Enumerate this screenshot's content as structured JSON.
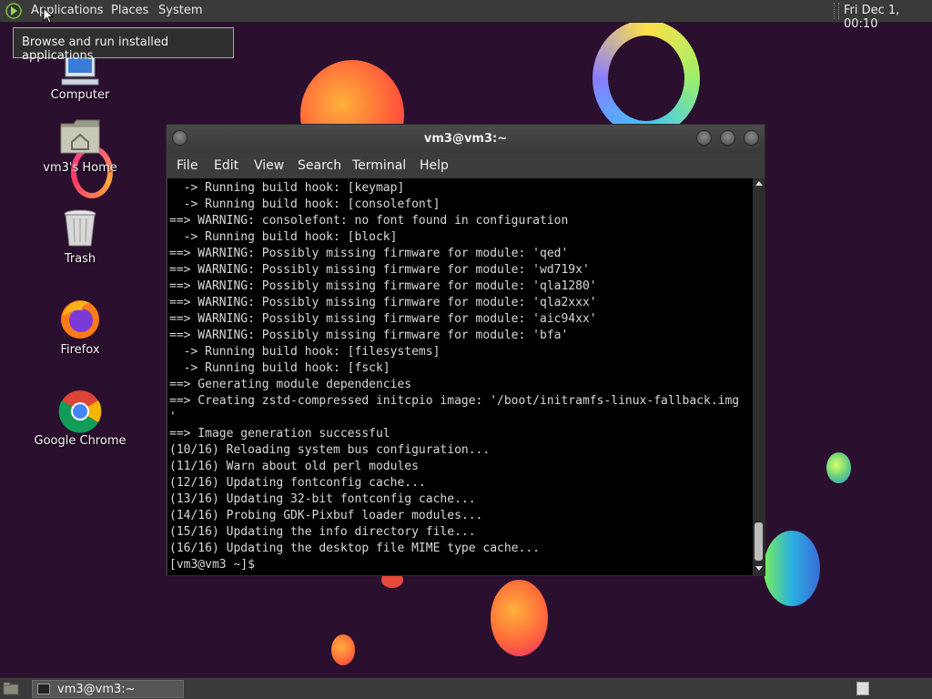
{
  "top_panel": {
    "applications": "Applications",
    "places": "Places",
    "system": "System",
    "clock": "Fri Dec 1, 00:10"
  },
  "tooltip": "Browse and run installed applications",
  "desktop_icons": {
    "computer": "Computer",
    "home": "vm3's Home",
    "trash": "Trash",
    "firefox": "Firefox",
    "chrome": "Google Chrome"
  },
  "terminal": {
    "title": "vm3@vm3:~",
    "menu": {
      "file": "File",
      "edit": "Edit",
      "view": "View",
      "search": "Search",
      "terminal": "Terminal",
      "help": "Help"
    },
    "lines": [
      "  -> Running build hook: [keymap]",
      "  -> Running build hook: [consolefont]",
      "==> WARNING: consolefont: no font found in configuration",
      "  -> Running build hook: [block]",
      "==> WARNING: Possibly missing firmware for module: 'qed'",
      "==> WARNING: Possibly missing firmware for module: 'wd719x'",
      "==> WARNING: Possibly missing firmware for module: 'qla1280'",
      "==> WARNING: Possibly missing firmware for module: 'qla2xxx'",
      "==> WARNING: Possibly missing firmware for module: 'aic94xx'",
      "==> WARNING: Possibly missing firmware for module: 'bfa'",
      "  -> Running build hook: [filesystems]",
      "  -> Running build hook: [fsck]",
      "==> Generating module dependencies",
      "==> Creating zstd-compressed initcpio image: '/boot/initramfs-linux-fallback.img",
      "'",
      "==> Image generation successful",
      "(10/16) Reloading system bus configuration...",
      "(11/16) Warn about old perl modules",
      "(12/16) Updating fontconfig cache...",
      "(13/16) Updating 32-bit fontconfig cache...",
      "(14/16) Probing GDK-Pixbuf loader modules...",
      "(15/16) Updating the info directory file...",
      "(16/16) Updating the desktop file MIME type cache...",
      "[vm3@vm3 ~]$ "
    ]
  },
  "taskbar": {
    "task_label": "vm3@vm3:~"
  }
}
